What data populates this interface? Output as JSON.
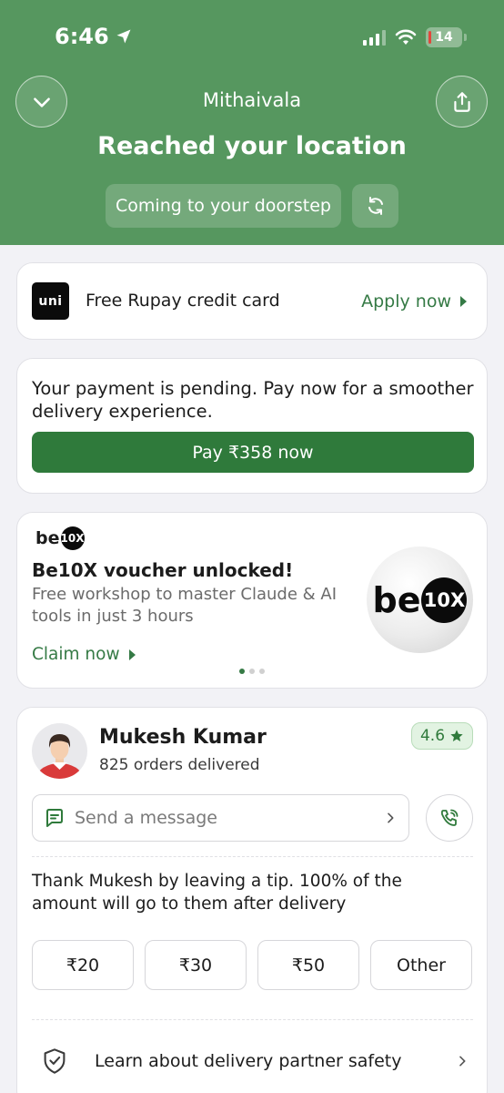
{
  "status_bar": {
    "time": "6:46",
    "battery": "14"
  },
  "header": {
    "restaurant": "Mithaivala",
    "headline": "Reached your location",
    "status_pill": "Coming to your doorstep"
  },
  "promo": {
    "logo_text": "uni",
    "text": "Free Rupay credit card",
    "cta": "Apply now"
  },
  "payment": {
    "message": "Your payment is pending. Pay now for a smoother delivery experience.",
    "button": "Pay ₹358 now"
  },
  "voucher": {
    "brand_prefix": "be",
    "brand_badge": "10X",
    "title": "Be10X voucher unlocked!",
    "description": "Free workshop to master Claude & AI tools in just 3 hours",
    "cta": "Claim now",
    "carousel_count": 3,
    "carousel_active": 1
  },
  "partner": {
    "name": "Mukesh Kumar",
    "orders": "825 orders delivered",
    "rating": "4.6",
    "message_placeholder": "Send a message",
    "tip_text": "Thank Mukesh by leaving a tip. 100% of the amount will go to them after delivery",
    "tips": [
      "₹20",
      "₹30",
      "₹50",
      "Other"
    ],
    "safety": "Learn about delivery partner safety"
  },
  "colors": {
    "header_green": "#56975f",
    "accent_green": "#2f7a3b",
    "link_green": "#357a45"
  },
  "icons": [
    "location-arrow-icon",
    "signal-icon",
    "wifi-icon",
    "battery-icon",
    "chevron-down-icon",
    "share-icon",
    "refresh-icon",
    "triangle-right-icon",
    "chat-icon",
    "chevron-right-icon",
    "phone-icon",
    "star-icon",
    "shield-check-icon"
  ]
}
